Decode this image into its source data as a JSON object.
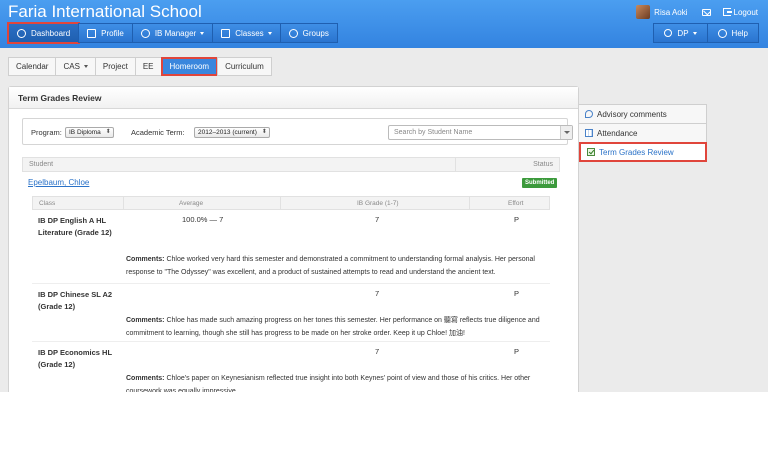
{
  "header": {
    "school_name": "Faria International School",
    "user_name": "Risa Aoki",
    "logout_label": "Logout"
  },
  "nav": {
    "items": [
      {
        "label": "Dashboard",
        "icon": "dashboard-icon",
        "active": true
      },
      {
        "label": "Profile",
        "icon": "profile-icon"
      },
      {
        "label": "IB Manager",
        "icon": "globe-icon",
        "dropdown": true
      },
      {
        "label": "Classes",
        "icon": "classes-icon",
        "dropdown": true
      },
      {
        "label": "Groups",
        "icon": "groups-icon"
      }
    ],
    "right": [
      {
        "label": "DP",
        "icon": "search-icon",
        "dropdown": true
      },
      {
        "label": "Help",
        "icon": "help-icon"
      }
    ]
  },
  "subnav": {
    "tabs": [
      {
        "label": "Calendar"
      },
      {
        "label": "CAS",
        "dropdown": true
      },
      {
        "label": "Project"
      },
      {
        "label": "EE"
      },
      {
        "label": "Homeroom",
        "active": true
      },
      {
        "label": "Curriculum"
      }
    ]
  },
  "panel": {
    "title": "Term Grades Review",
    "program_label": "Program:",
    "program_value": "IB Diploma",
    "term_label": "Academic Term:",
    "term_value": "2012–2013 (current)",
    "search_placeholder": "Search by Student Name",
    "col_student": "Student",
    "col_status": "Status",
    "student_name": "Epelbaum, Chloe",
    "status": "Submitted",
    "grades_headers": {
      "class": "Class",
      "average": "Average",
      "ib_grade": "IB Grade (1-7)",
      "effort": "Effort"
    },
    "comment_label": "Comments:",
    "rows": [
      {
        "class": "IB DP English A HL Literature (Grade 12)",
        "average": "100.0% — 7",
        "ib_grade": "7",
        "effort": "P",
        "comment": "Chloe worked very hard this semester and demonstrated a commitment to understanding formal analysis. Her personal response to \"The Odyssey\" was excellent, and a product of sustained attempts to read and understand the ancient text."
      },
      {
        "class": "IB DP Chinese SL A2 (Grade 12)",
        "average": "",
        "ib_grade": "7",
        "effort": "P",
        "comment": "Chloe has made such amazing progress on her tones this semester. Her performance on 聽寫 reflects true diligence and commitment to learning, though she still has progress to be made on her stroke order. Keep it up Chloe! 加油!"
      },
      {
        "class": "IB DP Economics HL (Grade 12)",
        "average": "",
        "ib_grade": "7",
        "effort": "P",
        "comment": "Chloe's paper on Keynesianism reflected true insight into both Keynes' point of view and those of his critics. Her other coursework was equally impressive."
      }
    ]
  },
  "sidebar": {
    "items": [
      {
        "label": "Advisory comments",
        "icon": "chat-icon"
      },
      {
        "label": "Attendance",
        "icon": "calendar-icon"
      },
      {
        "label": "Term Grades Review",
        "icon": "checkbox-icon",
        "active": true
      }
    ]
  }
}
